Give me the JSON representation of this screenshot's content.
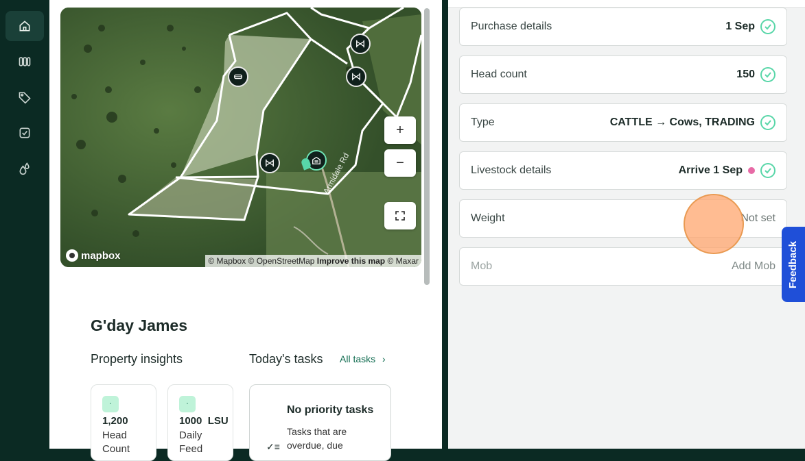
{
  "sidebar": {
    "items": [
      {
        "icon": "home-icon",
        "active": true
      },
      {
        "icon": "paddocks-icon",
        "active": false
      },
      {
        "icon": "tag-icon",
        "active": false
      },
      {
        "icon": "task-checkbox-icon",
        "active": false
      },
      {
        "icon": "water-drops-icon",
        "active": false
      }
    ]
  },
  "map": {
    "logo_text": "mapbox",
    "attribution": "© Mapbox © OpenStreetMap",
    "attribution_link": "Improve this map",
    "attribution_tail": "© Maxar",
    "road_label": "Armidale Rd",
    "zoom_in": "+",
    "zoom_out": "−",
    "fullscreen": "⛶"
  },
  "dashboard": {
    "greeting": "G'day James",
    "insights_title": "Property insights",
    "tasks_title": "Today's tasks",
    "all_tasks_link": "All tasks",
    "cards": [
      {
        "badge": "·",
        "value": "1,200",
        "label": "Head Count"
      },
      {
        "badge": "·",
        "value": "1000  LSU",
        "label": "Daily Feed"
      }
    ],
    "task_card": {
      "title": "No priority tasks",
      "body": "Tasks that are overdue, due"
    }
  },
  "panel": {
    "fields": [
      {
        "label": "Purchase details",
        "value": "1 Sep",
        "checked": true
      },
      {
        "label": "Head count",
        "value": "150",
        "checked": true
      },
      {
        "label": "Type",
        "value": "CATTLE → Cows, TRADING",
        "checked": true
      },
      {
        "label": "Livestock details",
        "value": "Arrive 1 Sep",
        "checked": true,
        "dot": true
      },
      {
        "label": "Weight",
        "value": "Not set",
        "checked": false
      },
      {
        "label": "Mob",
        "value": "Add Mob",
        "checked": false,
        "disabled": true
      }
    ]
  },
  "feedback_label": "Feedback",
  "colors": {
    "sidebar_bg": "#0b2a23",
    "accent_green": "#58d6a8",
    "feedback_blue": "#1f4fd8",
    "pink_status": "#e76aa6"
  }
}
